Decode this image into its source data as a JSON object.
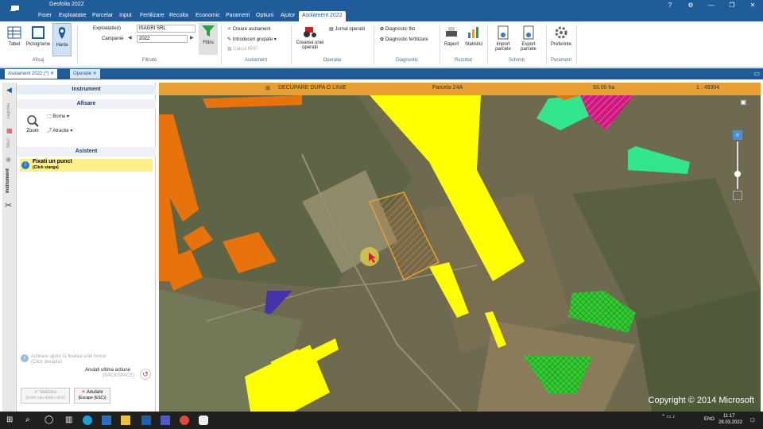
{
  "app": {
    "title": "Geofolia 2022"
  },
  "menu": {
    "items": [
      "Fisier",
      "Exploatatie",
      "Parcelar",
      "Input",
      "Fertilizare",
      "Recolta",
      "Economic",
      "Parametri",
      "Optiuni",
      "Ajutor"
    ],
    "active_tab": "Asolament 2022"
  },
  "ribbon": {
    "afisaj": {
      "group": "Afisaj",
      "tabel": "Tabel",
      "pictograme": "Pictograme",
      "harta": "Harta"
    },
    "filtrate": {
      "group": "Filtrate",
      "exploatatie_label": "Exploatatie(i)",
      "exploatatie_value": "ISAGRI SRL",
      "campanie_label": "Campanie",
      "campanie_value": "2022",
      "filtru": "Filtru"
    },
    "asolament": {
      "group": "Asolament",
      "creare": "Creare asolament",
      "introduceri": "Introduceri grupate",
      "calcul": "Calcul RPP"
    },
    "operatie": {
      "group": "Operatie",
      "crearea": "Crearea unei operatii",
      "jurnal": "Jurnal operatii"
    },
    "diagnostic": {
      "group": "Diagnostic",
      "fito": "Diagnostic fito",
      "fertilizare": "Diagnostic fertilizare"
    },
    "rezultat": {
      "group": "Rezultat",
      "raport": "Raport",
      "statistici": "Statistici"
    },
    "schimb": {
      "group": "Schimb",
      "import": "Import parcele",
      "export": "Export parcele"
    },
    "parametri": {
      "group": "Parametri",
      "preferinte": "Preferinte"
    }
  },
  "tabs": {
    "asolament": "Asolament 2022 (*)",
    "operatie": "Operatie"
  },
  "sidebar": {
    "legenda": "Legenda",
    "stiluri": "Stiluri",
    "instrument": "Instrument"
  },
  "panel": {
    "header": "Instrument",
    "afisare": "Afisare",
    "zoom": "Zoom",
    "borne": "Borne",
    "atractie": "Atractie",
    "asistent": "Asistent",
    "hint_title": "Fixati un punct",
    "hint_sub": "(Click stanga)",
    "help1": "Activare ajutor la fixarea unei borne",
    "help2": "(Click dreapta)",
    "undo_label": "Anulati ultima actiune",
    "undo_key": "(BACKSPACE)",
    "validate": "Validare",
    "validate_sub": "(Enter sau dublu-click)",
    "cancel": "Anulare",
    "cancel_sub": "(Escape (ESC))"
  },
  "map": {
    "mode": "DECUPARE DUPA O LINIE",
    "parcel": "Parcela 24A",
    "area": "93.00 ha",
    "scale": "1 : 49304",
    "copyright": "Copyright © 2014 Microsoft"
  },
  "taskbar": {
    "lang": "ENG",
    "time": "11:17",
    "date": "28.03.2022"
  },
  "colors": {
    "brand": "#1f5c99",
    "orange": "#e8720c",
    "yellow": "#ffff00",
    "green": "#33cc33",
    "mint": "#33e68c",
    "magenta": "#cc1a80",
    "purple": "#4433aa",
    "selected": "#cc8a30"
  }
}
